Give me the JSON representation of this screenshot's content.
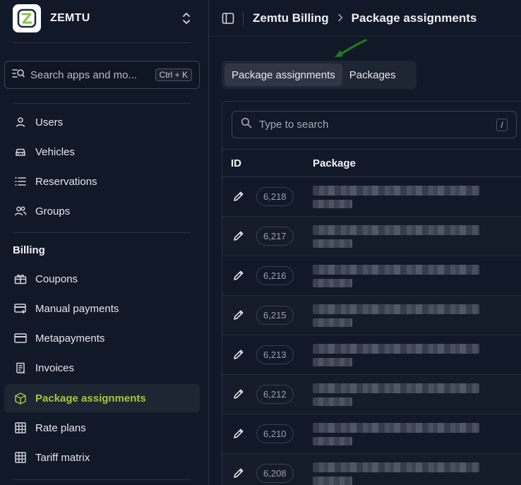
{
  "brand": {
    "name": "ZEMTU",
    "logo_icon": "zemtu-logo-icon"
  },
  "search": {
    "placeholder": "Search apps and mo...",
    "shortcut": "Ctrl + K"
  },
  "nav_primary": [
    {
      "label": "Users",
      "icon": "user-icon"
    },
    {
      "label": "Vehicles",
      "icon": "car-icon"
    },
    {
      "label": "Reservations",
      "icon": "list-icon"
    },
    {
      "label": "Groups",
      "icon": "users-icon"
    }
  ],
  "billing": {
    "title": "Billing",
    "items": [
      {
        "label": "Coupons",
        "icon": "gift-icon"
      },
      {
        "label": "Manual payments",
        "icon": "card-plus-icon"
      },
      {
        "label": "Metapayments",
        "icon": "credit-card-icon"
      },
      {
        "label": "Invoices",
        "icon": "receipt-icon"
      },
      {
        "label": "Package assignments",
        "icon": "package-icon",
        "active": true
      },
      {
        "label": "Rate plans",
        "icon": "grid-icon"
      },
      {
        "label": "Tariff matrix",
        "icon": "grid-icon"
      }
    ]
  },
  "breadcrumb": {
    "parent": "Zemtu Billing",
    "current": "Package assignments"
  },
  "tabs": [
    {
      "label": "Package assignments",
      "active": true
    },
    {
      "label": "Packages",
      "active": false
    }
  ],
  "table": {
    "search_placeholder": "Type to search",
    "search_shortcut": "/",
    "columns": [
      "ID",
      "Package"
    ],
    "rows": [
      {
        "id": "6,218"
      },
      {
        "id": "6,217"
      },
      {
        "id": "6,216"
      },
      {
        "id": "6,215"
      },
      {
        "id": "6,213"
      },
      {
        "id": "6,212"
      },
      {
        "id": "6,210"
      },
      {
        "id": "6,208"
      }
    ]
  },
  "colors": {
    "accent": "#a3c93a",
    "background": "#111827",
    "arrow": "#1f7a1f"
  }
}
